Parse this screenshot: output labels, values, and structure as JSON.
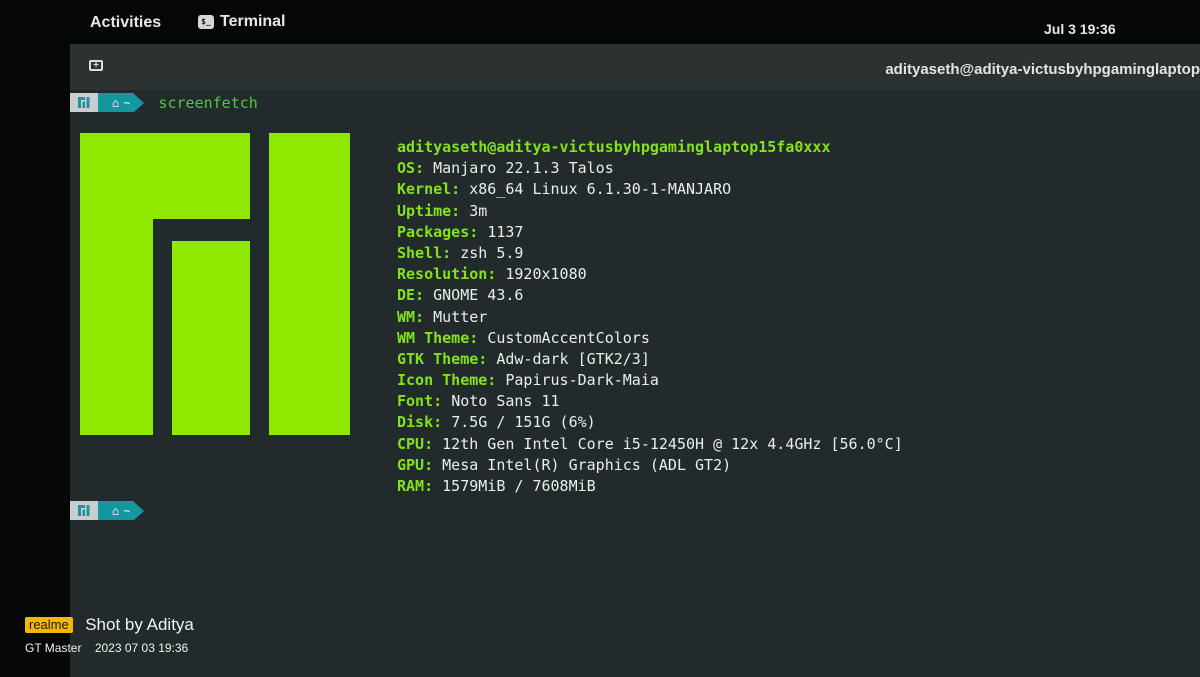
{
  "topbar": {
    "activities": "Activities",
    "app_name": "Terminal",
    "app_icon": "terminal-icon",
    "app_icon_glyph": "$_",
    "clock": "Jul 3  19:36"
  },
  "headerbar": {
    "new_tab_icon": "new-tab-icon",
    "new_tab_glyph": "+",
    "title": "adityaseth@aditya-victusbyhpgaminglaptop"
  },
  "prompt": {
    "home_glyph": "⌂",
    "dir": "~",
    "command": "screenfetch"
  },
  "info": {
    "userhost": "adityaseth@aditya-victusbyhpgaminglaptop15fa0xxx",
    "rows": [
      {
        "label": "OS:",
        "value": "Manjaro 22.1.3 Talos"
      },
      {
        "label": "Kernel:",
        "value": "x86_64 Linux 6.1.30-1-MANJARO"
      },
      {
        "label": "Uptime:",
        "value": "3m"
      },
      {
        "label": "Packages:",
        "value": "1137"
      },
      {
        "label": "Shell:",
        "value": "zsh 5.9"
      },
      {
        "label": "Resolution:",
        "value": "1920x1080"
      },
      {
        "label": "DE:",
        "value": "GNOME 43.6"
      },
      {
        "label": "WM:",
        "value": "Mutter"
      },
      {
        "label": "WM Theme:",
        "value": "CustomAccentColors"
      },
      {
        "label": "GTK Theme:",
        "value": "Adw-dark [GTK2/3]"
      },
      {
        "label": "Icon Theme:",
        "value": "Papirus-Dark-Maia"
      },
      {
        "label": "Font:",
        "value": "Noto Sans 11"
      },
      {
        "label": "Disk:",
        "value": "7.5G / 151G (6%)"
      },
      {
        "label": "CPU:",
        "value": "12th Gen Intel Core i5-12450H @ 12x 4.4GHz [56.0°C]"
      },
      {
        "label": "GPU:",
        "value": "Mesa Intel(R) Graphics (ADL GT2)"
      },
      {
        "label": "RAM:",
        "value": "1579MiB / 7608MiB"
      }
    ]
  },
  "watermark": {
    "brand": "realme",
    "shot_by": "Shot by Aditya",
    "device": "GT Master",
    "datetime": "2023 07 03 19:36"
  },
  "colors": {
    "logo_green": "#8ee800",
    "label_green": "#84e21c",
    "prompt_teal": "#1597a0",
    "terminal_bg": "#222b2b"
  }
}
